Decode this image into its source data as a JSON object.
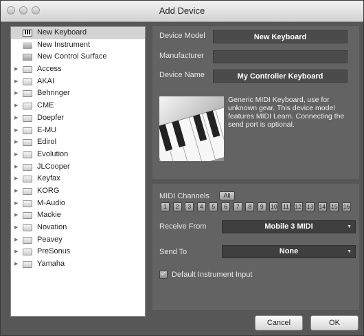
{
  "window": {
    "title": "Add Device"
  },
  "device_list": {
    "items": [
      {
        "label": "New Keyboard",
        "type": "keyboard",
        "icon": "keyboard-icon",
        "selected": true,
        "expandable": false
      },
      {
        "label": "New Instrument",
        "type": "instrument",
        "icon": "instrument-icon",
        "selected": false,
        "expandable": false
      },
      {
        "label": "New Control Surface",
        "type": "control",
        "icon": "control-surface-icon",
        "selected": false,
        "expandable": false
      },
      {
        "label": "Access",
        "type": "folder",
        "icon": "folder-icon",
        "expandable": true
      },
      {
        "label": "AKAI",
        "type": "folder",
        "icon": "folder-icon",
        "expandable": true
      },
      {
        "label": "Behringer",
        "type": "folder",
        "icon": "folder-icon",
        "expandable": true
      },
      {
        "label": "CME",
        "type": "folder",
        "icon": "folder-icon",
        "expandable": true
      },
      {
        "label": "Doepfer",
        "type": "folder",
        "icon": "folder-icon",
        "expandable": true
      },
      {
        "label": "E-MU",
        "type": "folder",
        "icon": "folder-icon",
        "expandable": true
      },
      {
        "label": "Edirol",
        "type": "folder",
        "icon": "folder-icon",
        "expandable": true
      },
      {
        "label": "Evolution",
        "type": "folder",
        "icon": "folder-icon",
        "expandable": true
      },
      {
        "label": "JLCooper",
        "type": "folder",
        "icon": "folder-icon",
        "expandable": true
      },
      {
        "label": "Keyfax",
        "type": "folder",
        "icon": "folder-icon",
        "expandable": true
      },
      {
        "label": "KORG",
        "type": "folder",
        "icon": "folder-icon",
        "expandable": true
      },
      {
        "label": "M-Audio",
        "type": "folder",
        "icon": "folder-icon",
        "expandable": true
      },
      {
        "label": "Mackie",
        "type": "folder",
        "icon": "folder-icon",
        "expandable": true
      },
      {
        "label": "Novation",
        "type": "folder",
        "icon": "folder-icon",
        "expandable": true
      },
      {
        "label": "Peavey",
        "type": "folder",
        "icon": "folder-icon",
        "expandable": true
      },
      {
        "label": "PreSonus",
        "type": "folder",
        "icon": "folder-icon",
        "expandable": true
      },
      {
        "label": "Yamaha",
        "type": "folder",
        "icon": "folder-icon",
        "expandable": true
      }
    ]
  },
  "device": {
    "model_label": "Device Model",
    "model_value": "New Keyboard",
    "manufacturer_label": "Manufacturer",
    "manufacturer_value": "",
    "name_label": "Device Name",
    "name_value": "My Controller Keyboard",
    "description": "Generic MIDI Keyboard, use for unknown gear. This device model features MIDI Learn. Connecting the send port is optional."
  },
  "midi": {
    "channels_label": "MIDI Channels",
    "all_label": "All",
    "channels": [
      "1",
      "2",
      "3",
      "4",
      "5",
      "6",
      "7",
      "8",
      "9",
      "10",
      "11",
      "12",
      "13",
      "14",
      "15",
      "16"
    ],
    "receive_label": "Receive From",
    "receive_value": "Mobile 3 MIDI",
    "send_label": "Send To",
    "send_value": "None",
    "default_input_label": "Default Instrument Input",
    "default_input_checked": true
  },
  "buttons": {
    "cancel": "Cancel",
    "ok": "OK"
  }
}
